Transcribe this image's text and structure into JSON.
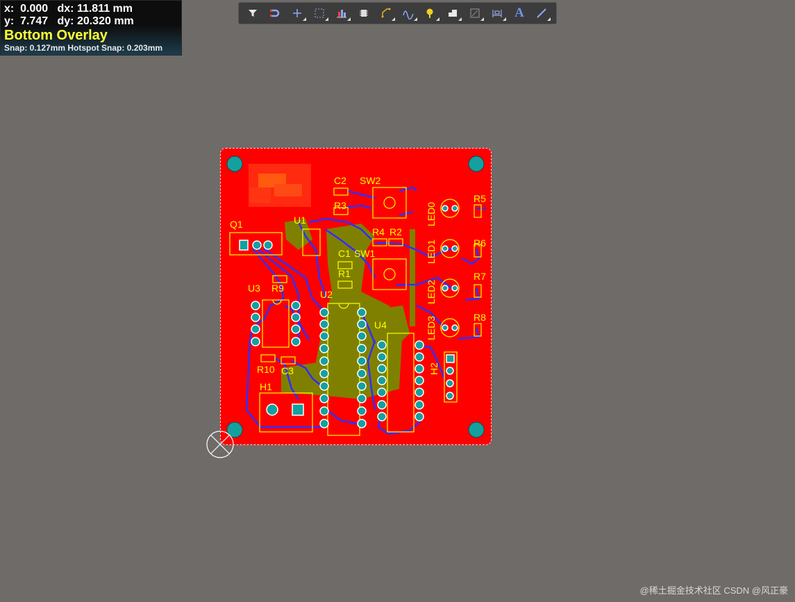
{
  "hud": {
    "line1": "x:  0.000   dx: 11.811 mm",
    "line2": "y:  7.747   dy: 20.320 mm",
    "layer": "Bottom Overlay",
    "snap": "Snap: 0.127mm Hotspot Snap: 0.203mm"
  },
  "toolbar": {
    "buttons": [
      "filter-icon",
      "magnet-icon",
      "crosshair-icon",
      "select-rect-icon",
      "align-icon",
      "component-icon",
      "route-icon",
      "diff-pair-icon",
      "pin-icon",
      "fill-icon",
      "keepout-icon",
      "dimension-icon",
      "text-icon",
      "line-icon"
    ],
    "text_button_glyph": "A"
  },
  "designators": {
    "c2": "C2",
    "sw2": "SW2",
    "r3": "R3",
    "r5": "R5",
    "led0": "LED0",
    "q1": "Q1",
    "u1": "U1",
    "r4": "R4",
    "r2": "R2",
    "c1": "C1",
    "sw1": "SW1",
    "led1": "LED1",
    "r6": "R6",
    "r1": "R1",
    "r7": "R7",
    "led2": "LED2",
    "u3": "U3",
    "r9": "R9",
    "u2": "U2",
    "r8": "R8",
    "led3": "LED3",
    "u4": "U4",
    "h2": "H2",
    "r10": "R10",
    "c3": "C3",
    "h1": "H1"
  },
  "colors": {
    "board": "#ff0000",
    "silkscreen": "#ffff00",
    "bottom_trace": "#3030ff",
    "pad": "#15a0a0",
    "overlay_art": "#808000",
    "background": "#6f6b69"
  },
  "watermark": "@稀土掘金技术社区  CSDN @风正豪"
}
